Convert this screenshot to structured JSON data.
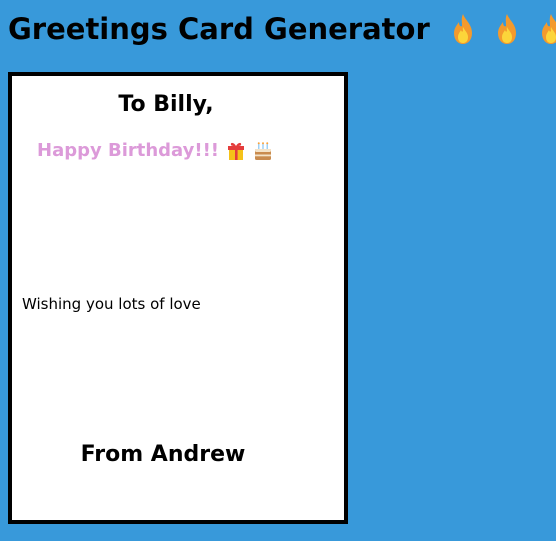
{
  "header": {
    "title": "Greetings Card Generator",
    "icons": [
      "fire-icon",
      "fire-icon",
      "fire-icon"
    ]
  },
  "card": {
    "to": "To Billy,",
    "greeting": "Happy Birthday!!!",
    "greeting_icons": [
      "gift-icon",
      "birthday-cake-icon"
    ],
    "message": "Wishing you lots of love",
    "from": "From Andrew"
  },
  "colors": {
    "background": "#3899da",
    "card_background": "#ffffff",
    "card_border": "#000000",
    "greeting": "#dc9ad9",
    "fire_outer": "#f39a2d",
    "fire_inner": "#fcd53a"
  }
}
